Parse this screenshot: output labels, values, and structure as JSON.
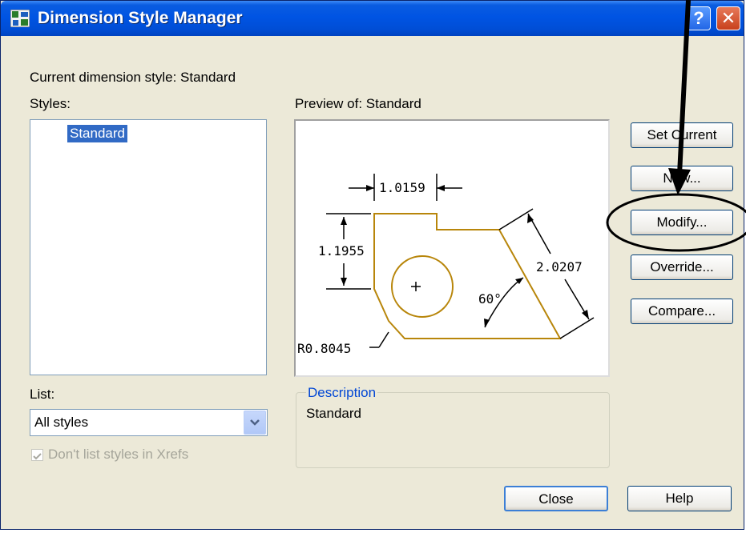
{
  "window": {
    "title": "Dimension Style Manager",
    "help_label": "?",
    "close_label": "✕"
  },
  "current_style": {
    "label": "Current dimension style: Standard"
  },
  "styles": {
    "label": "Styles:",
    "items": [
      "Standard"
    ],
    "selected": "Standard"
  },
  "preview": {
    "label": "Preview of: Standard",
    "dims": {
      "width": "1.0159",
      "height": "1.1955",
      "diagonal": "2.0207",
      "angle": "60°",
      "radius": "R0.8045"
    }
  },
  "buttons": {
    "set_current": "Set Current",
    "new": "New...",
    "modify": "Modify...",
    "override": "Override...",
    "compare": "Compare...",
    "close": "Close",
    "help": "Help"
  },
  "list": {
    "label": "List:",
    "value": "All styles"
  },
  "xrefs_checkbox": {
    "label": "Don't list styles in Xrefs",
    "checked": true,
    "disabled": true
  },
  "description": {
    "legend": "Description",
    "text": "Standard"
  },
  "colors": {
    "title_bar": "#0054e3",
    "dialog_bg": "#ece9d8",
    "selection": "#316ac5",
    "preview_geometry": "#b8860b",
    "legend_text": "#0046d5"
  }
}
